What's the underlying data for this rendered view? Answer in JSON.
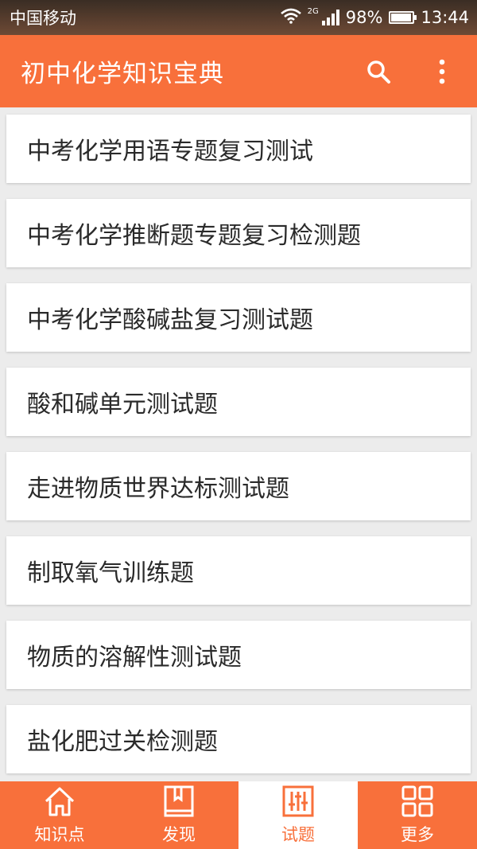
{
  "status_bar": {
    "carrier": "中国移动",
    "network_tag": "2G",
    "battery": "98%",
    "time": "13:44"
  },
  "app_bar": {
    "title": "初中化学知识宝典",
    "search_icon": "search-icon",
    "more_icon": "more-vert-icon"
  },
  "list": {
    "items": [
      "中考化学用语专题复习测试",
      "中考化学推断题专题复习检测题",
      "中考化学酸碱盐复习测试题",
      "酸和碱单元测试题",
      "走进物质世界达标测试题",
      "制取氧气训练题",
      "物质的溶解性测试题",
      "盐化肥过关检测题"
    ]
  },
  "bottom_nav": {
    "items": [
      {
        "label": "知识点",
        "icon": "home-icon"
      },
      {
        "label": "发现",
        "icon": "book-icon"
      },
      {
        "label": "试题",
        "icon": "sliders-icon"
      },
      {
        "label": "更多",
        "icon": "grid-icon"
      }
    ],
    "active_index": 2
  },
  "colors": {
    "primary": "#f8703b",
    "text": "#2a2a2a",
    "background": "#ececec"
  }
}
